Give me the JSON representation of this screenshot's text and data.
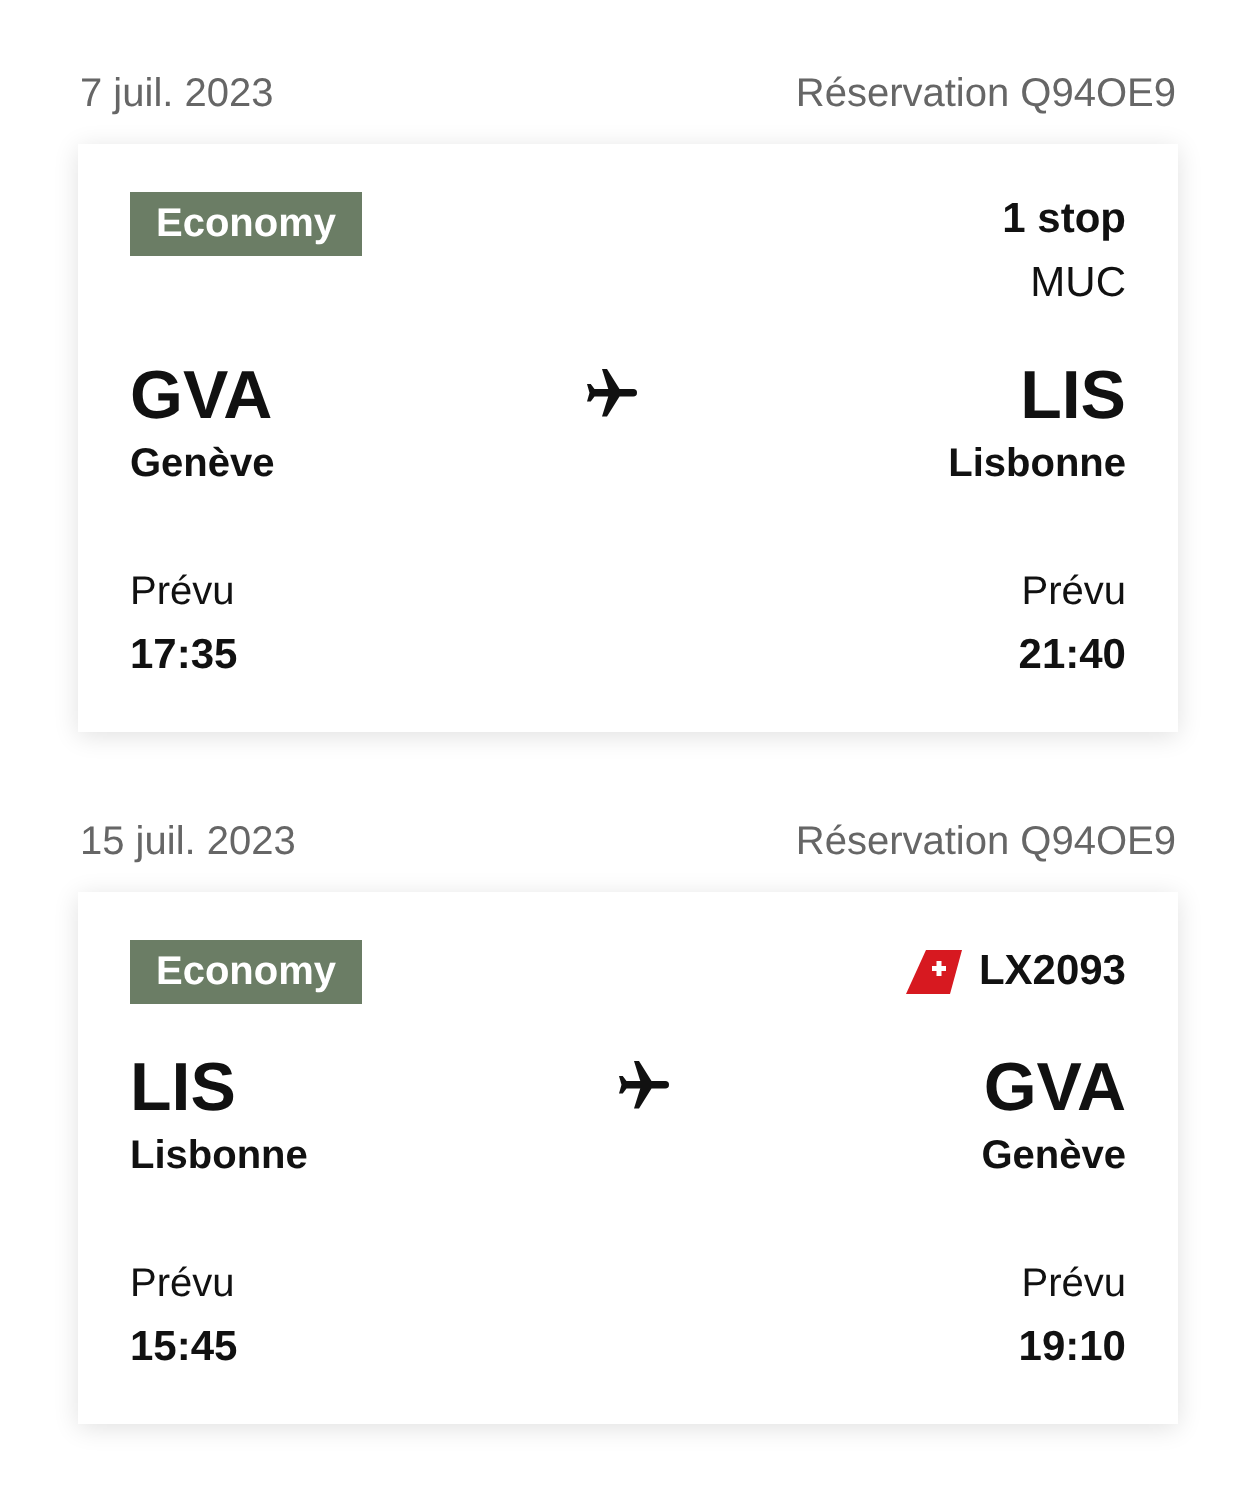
{
  "trips": [
    {
      "date": "7 juil. 2023",
      "booking": "Réservation Q94OE9",
      "cabin": "Economy",
      "info": {
        "kind": "stops",
        "title": "1 stop",
        "detail": "MUC"
      },
      "origin": {
        "code": "GVA",
        "city": "Genève",
        "time_label": "Prévu",
        "time": "17:35"
      },
      "destination": {
        "code": "LIS",
        "city": "Lisbonne",
        "time_label": "Prévu",
        "time": "21:40"
      }
    },
    {
      "date": "15 juil. 2023",
      "booking": "Réservation Q94OE9",
      "cabin": "Economy",
      "info": {
        "kind": "flight",
        "title": "LX2093"
      },
      "origin": {
        "code": "LIS",
        "city": "Lisbonne",
        "time_label": "Prévu",
        "time": "15:45"
      },
      "destination": {
        "code": "GVA",
        "city": "Genève",
        "time_label": "Prévu",
        "time": "19:10"
      }
    }
  ]
}
